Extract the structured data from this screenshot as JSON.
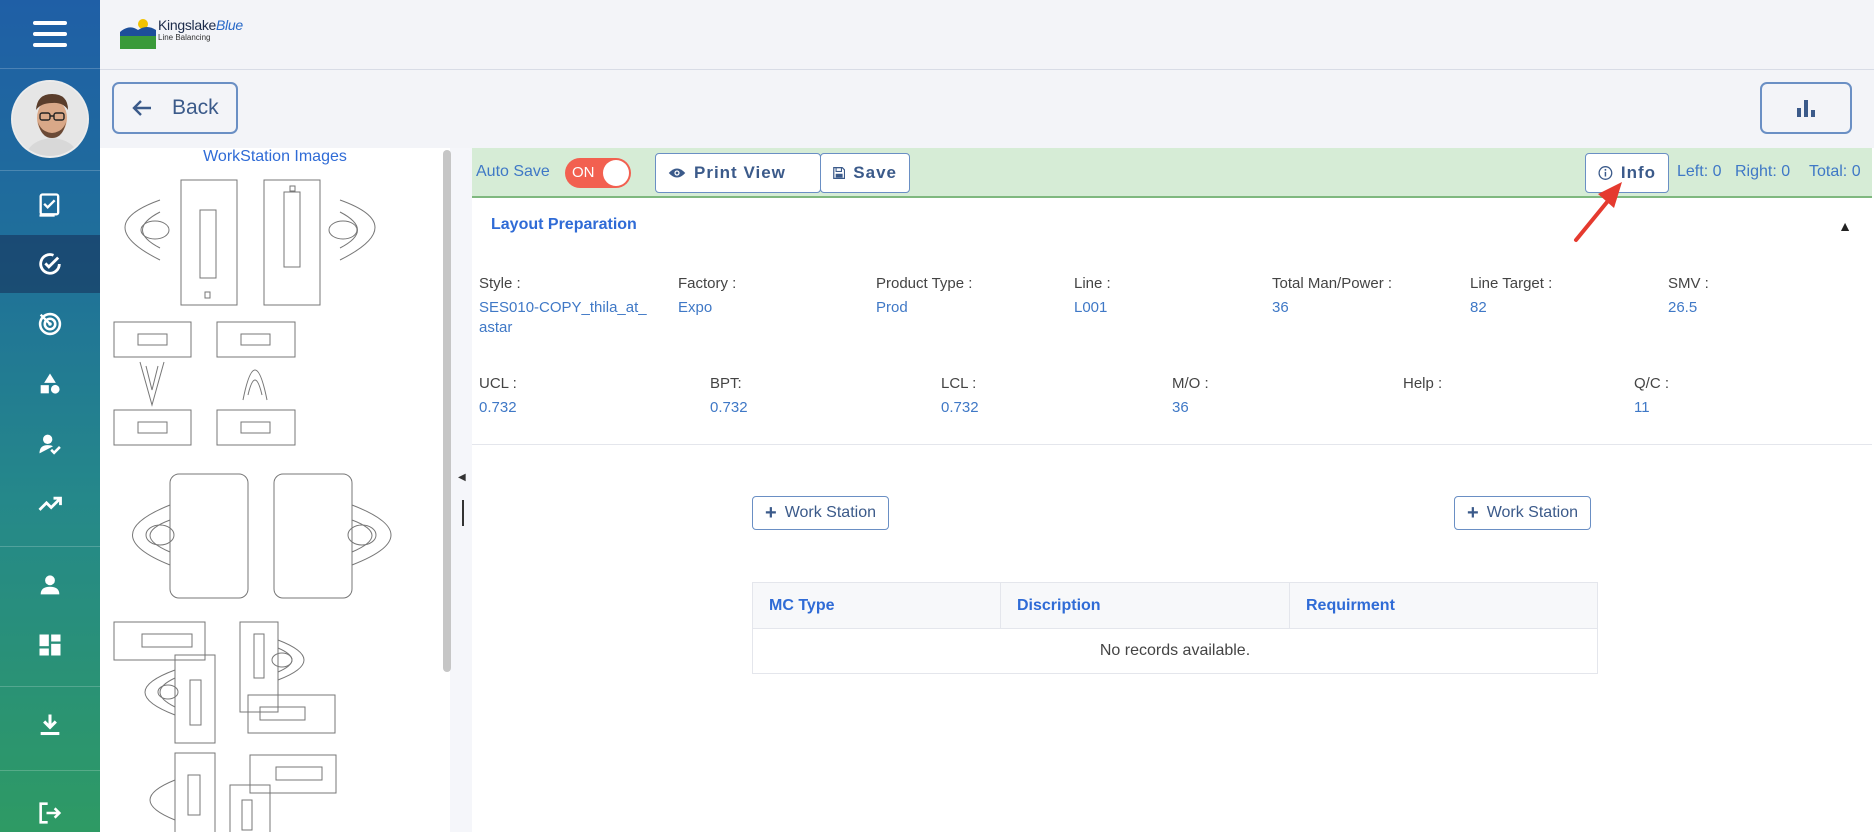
{
  "app": {
    "brand_primary": "Kingslake",
    "brand_accent": "Blue",
    "brand_subtitle": "Line Balancing"
  },
  "nav": {
    "back_label": "Back",
    "items": [
      {
        "icon": "checklist-icon"
      },
      {
        "icon": "check-circle-icon",
        "active": true
      },
      {
        "icon": "target-icon"
      },
      {
        "icon": "shapes-icon"
      },
      {
        "icon": "user-check-icon"
      },
      {
        "icon": "trending-icon"
      },
      {
        "icon": "person-icon"
      },
      {
        "icon": "dashboard-icon"
      },
      {
        "icon": "download-icon"
      },
      {
        "icon": "logout-icon"
      }
    ]
  },
  "workstation_panel": {
    "title": "WorkStation Images"
  },
  "toolbar": {
    "autosave_label": "Auto Save",
    "toggle_text": "ON",
    "print_label": "Print View",
    "save_label": "Save",
    "info_label": "Info",
    "left": "Left: 0",
    "right": "Right: 0",
    "total": "Total: 0"
  },
  "layout": {
    "title": "Layout Preparation",
    "row1": [
      {
        "label": "Style :",
        "value": "SES010-COPY_thila_at_astar"
      },
      {
        "label": "Factory :",
        "value": "Expo"
      },
      {
        "label": "Product Type :",
        "value": "Prod"
      },
      {
        "label": "Line :",
        "value": "L001"
      },
      {
        "label": "Total Man/Power :",
        "value": "36"
      },
      {
        "label": "Line Target :",
        "value": "82"
      },
      {
        "label": "SMV :",
        "value": "26.5"
      }
    ],
    "row2": [
      {
        "label": "UCL :",
        "value": "0.732"
      },
      {
        "label": "BPT:",
        "value": "0.732"
      },
      {
        "label": "LCL :",
        "value": "0.732"
      },
      {
        "label": "M/O :",
        "value": "36"
      },
      {
        "label": "Help :",
        "value": ""
      },
      {
        "label": "Q/C :",
        "value": "11"
      }
    ]
  },
  "actions": {
    "add_workstation_left": "Work Station",
    "add_workstation_right": "Work Station"
  },
  "table": {
    "columns": [
      "MC Type",
      "Discription",
      "Requirment"
    ],
    "empty_text": "No records available."
  },
  "colors": {
    "accent": "#2f6bd6",
    "toolbar_bg": "#d6ecd6",
    "toggle_on": "#f26050",
    "annotation_arrow": "#e53a2f"
  }
}
